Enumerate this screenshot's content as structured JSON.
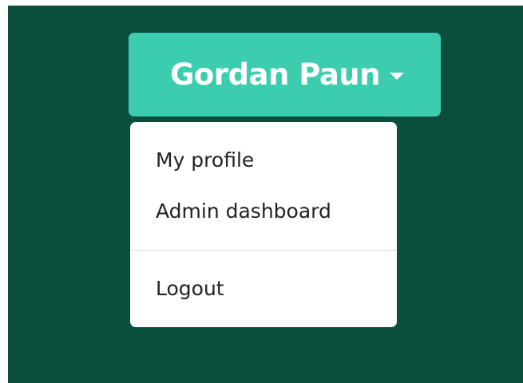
{
  "user_menu": {
    "username": "Gordan Paun",
    "caret_icon": "caret-down-icon",
    "items": [
      {
        "label": "My profile"
      },
      {
        "label": "Admin dashboard"
      },
      {
        "label": "Logout"
      }
    ]
  },
  "colors": {
    "background": "#0a4f3e",
    "button": "#3ccdae",
    "button_text": "#ffffff",
    "menu_background": "#ffffff",
    "menu_text": "#222222"
  }
}
